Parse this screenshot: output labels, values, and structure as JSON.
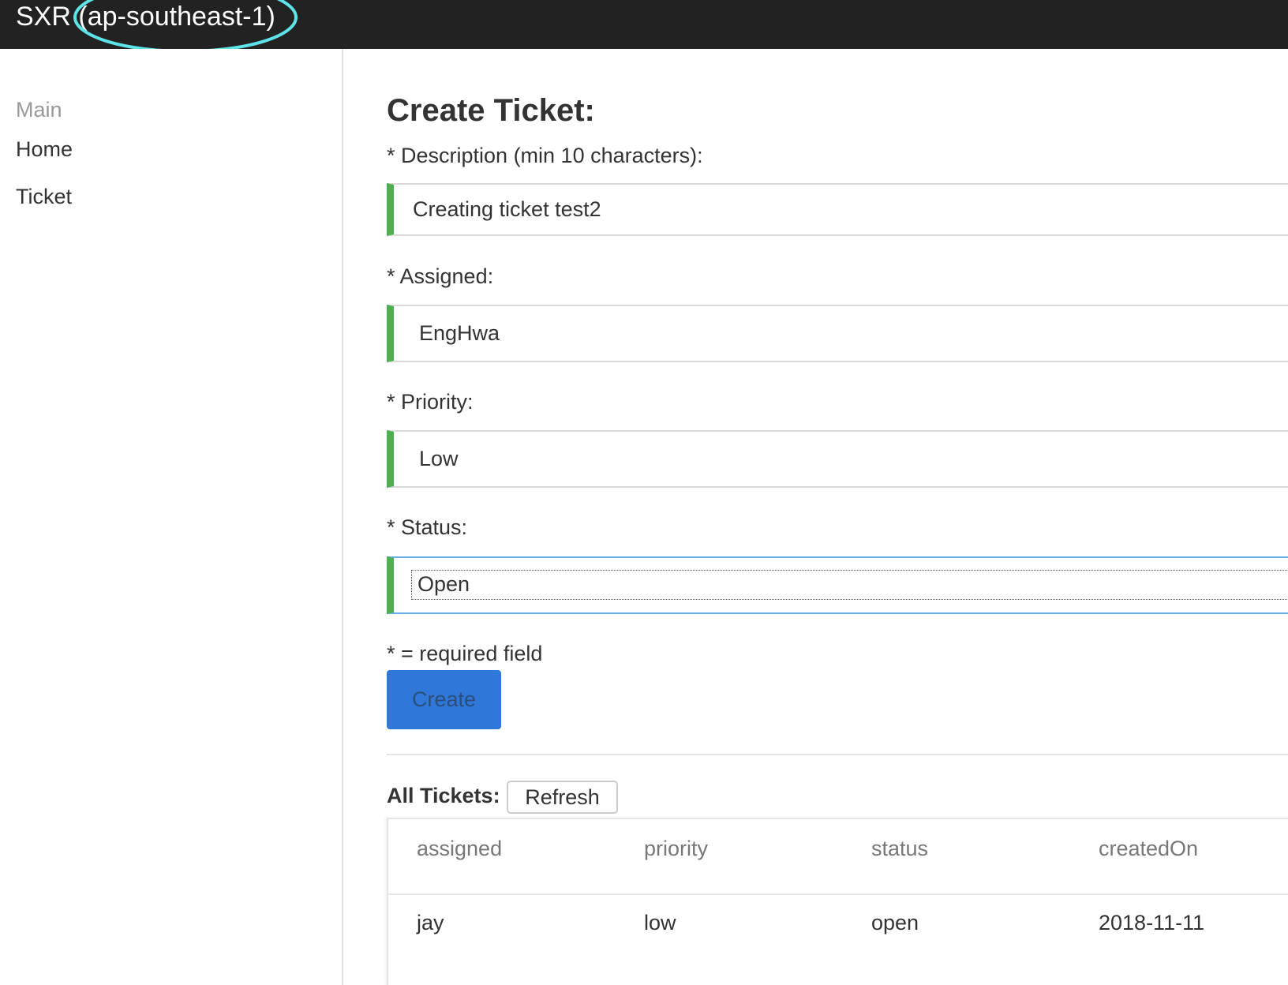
{
  "app": {
    "brand_name": "SXR",
    "region": "(ap-southeast-1)"
  },
  "sidebar": {
    "header": "Main",
    "items": [
      {
        "label": "Home"
      },
      {
        "label": "Ticket"
      }
    ]
  },
  "form": {
    "title": "Create Ticket:",
    "description": {
      "label": "* Description (min 10 characters):",
      "value": "Creating ticket test2"
    },
    "assigned": {
      "label": "* Assigned:",
      "value": "EngHwa"
    },
    "priority": {
      "label": "* Priority:",
      "value": "Low"
    },
    "status": {
      "label": "* Status:",
      "value": "Open"
    },
    "required_note": "* = required field",
    "create_label": "Create"
  },
  "tickets": {
    "label": "All Tickets:",
    "refresh_label": "Refresh",
    "columns": [
      "assigned",
      "priority",
      "status",
      "createdOn"
    ],
    "rows": [
      [
        "jay",
        "low",
        "open",
        "2018-11-11"
      ]
    ]
  },
  "colors": {
    "topbar": "#222222",
    "annotation_circle": "#5de3e8",
    "valid_field_accent": "#4caf50",
    "primary_button": "#2f77d9",
    "focus_border": "#66afe9"
  }
}
